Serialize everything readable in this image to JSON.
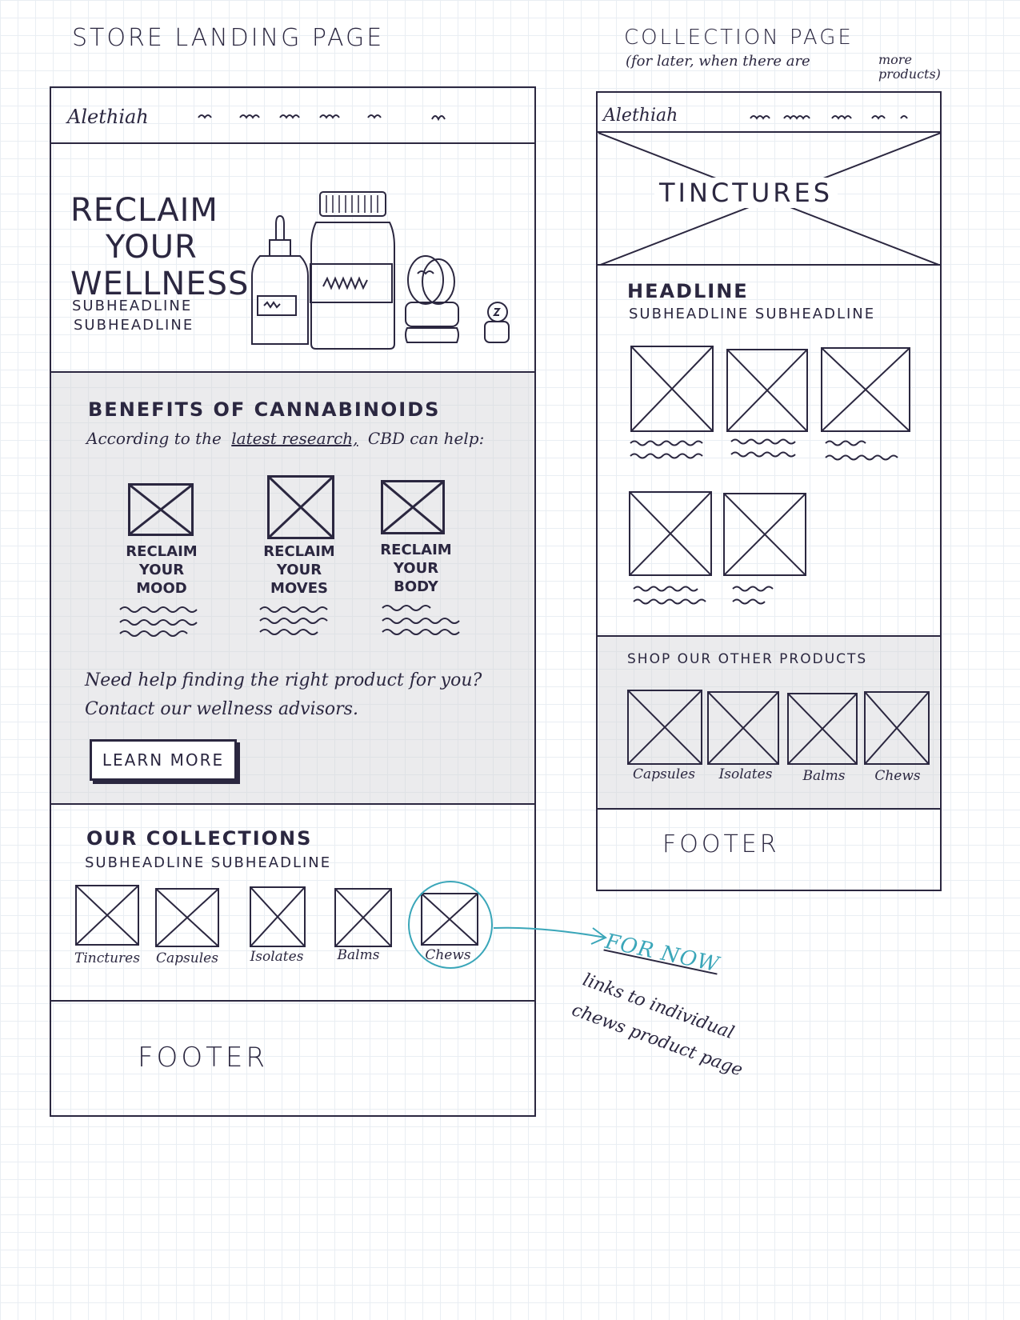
{
  "left_title": "STORE LANDING PAGE",
  "right_title": "COLLECTION PAGE",
  "right_subtitle_line1": "(for later, when there are",
  "right_subtitle_line2": "more products)",
  "store": {
    "logo": "Alethiah",
    "hero": {
      "headline_lines": [
        "RECLAIM",
        "YOUR",
        "WELLNESS"
      ],
      "subheadline_1": "SUBHEADLINE",
      "subheadline_2": "SUBHEADLINE"
    },
    "benefits": {
      "title": "BENEFITS OF CANNABINOIDS",
      "intro_before": "According to the",
      "intro_link": "latest research,",
      "intro_after": "CBD can help:",
      "cards": [
        {
          "lines": [
            "RECLAIM",
            "YOUR",
            "MOOD"
          ]
        },
        {
          "lines": [
            "RECLAIM",
            "YOUR",
            "MOVES"
          ]
        },
        {
          "lines": [
            "RECLAIM",
            "YOUR",
            "BODY"
          ]
        }
      ],
      "help_line1": "Need help finding the right product for you?",
      "help_line2": "Contact our wellness advisors.",
      "cta": "LEARN MORE"
    },
    "collections": {
      "title": "OUR COLLECTIONS",
      "subheadline": "SUBHEADLINE SUBHEADLINE",
      "items": [
        "Tinctures",
        "Capsules",
        "Isolates",
        "Balms",
        "Chews"
      ]
    },
    "footer": "FOOTER"
  },
  "collection_page": {
    "logo": "Alethiah",
    "hero_title": "TINCTURES",
    "headline": "HEADLINE",
    "subheadline": "SUBHEADLINE SUBHEADLINE",
    "other_title": "SHOP OUR OTHER PRODUCTS",
    "other_items": [
      "Capsules",
      "Isolates",
      "Balms",
      "Chews"
    ],
    "footer": "FOOTER"
  },
  "annotation": {
    "title": "FOR NOW",
    "lines": [
      "links to individual",
      "chews product page"
    ],
    "accent_color": "#3aa6b9"
  }
}
